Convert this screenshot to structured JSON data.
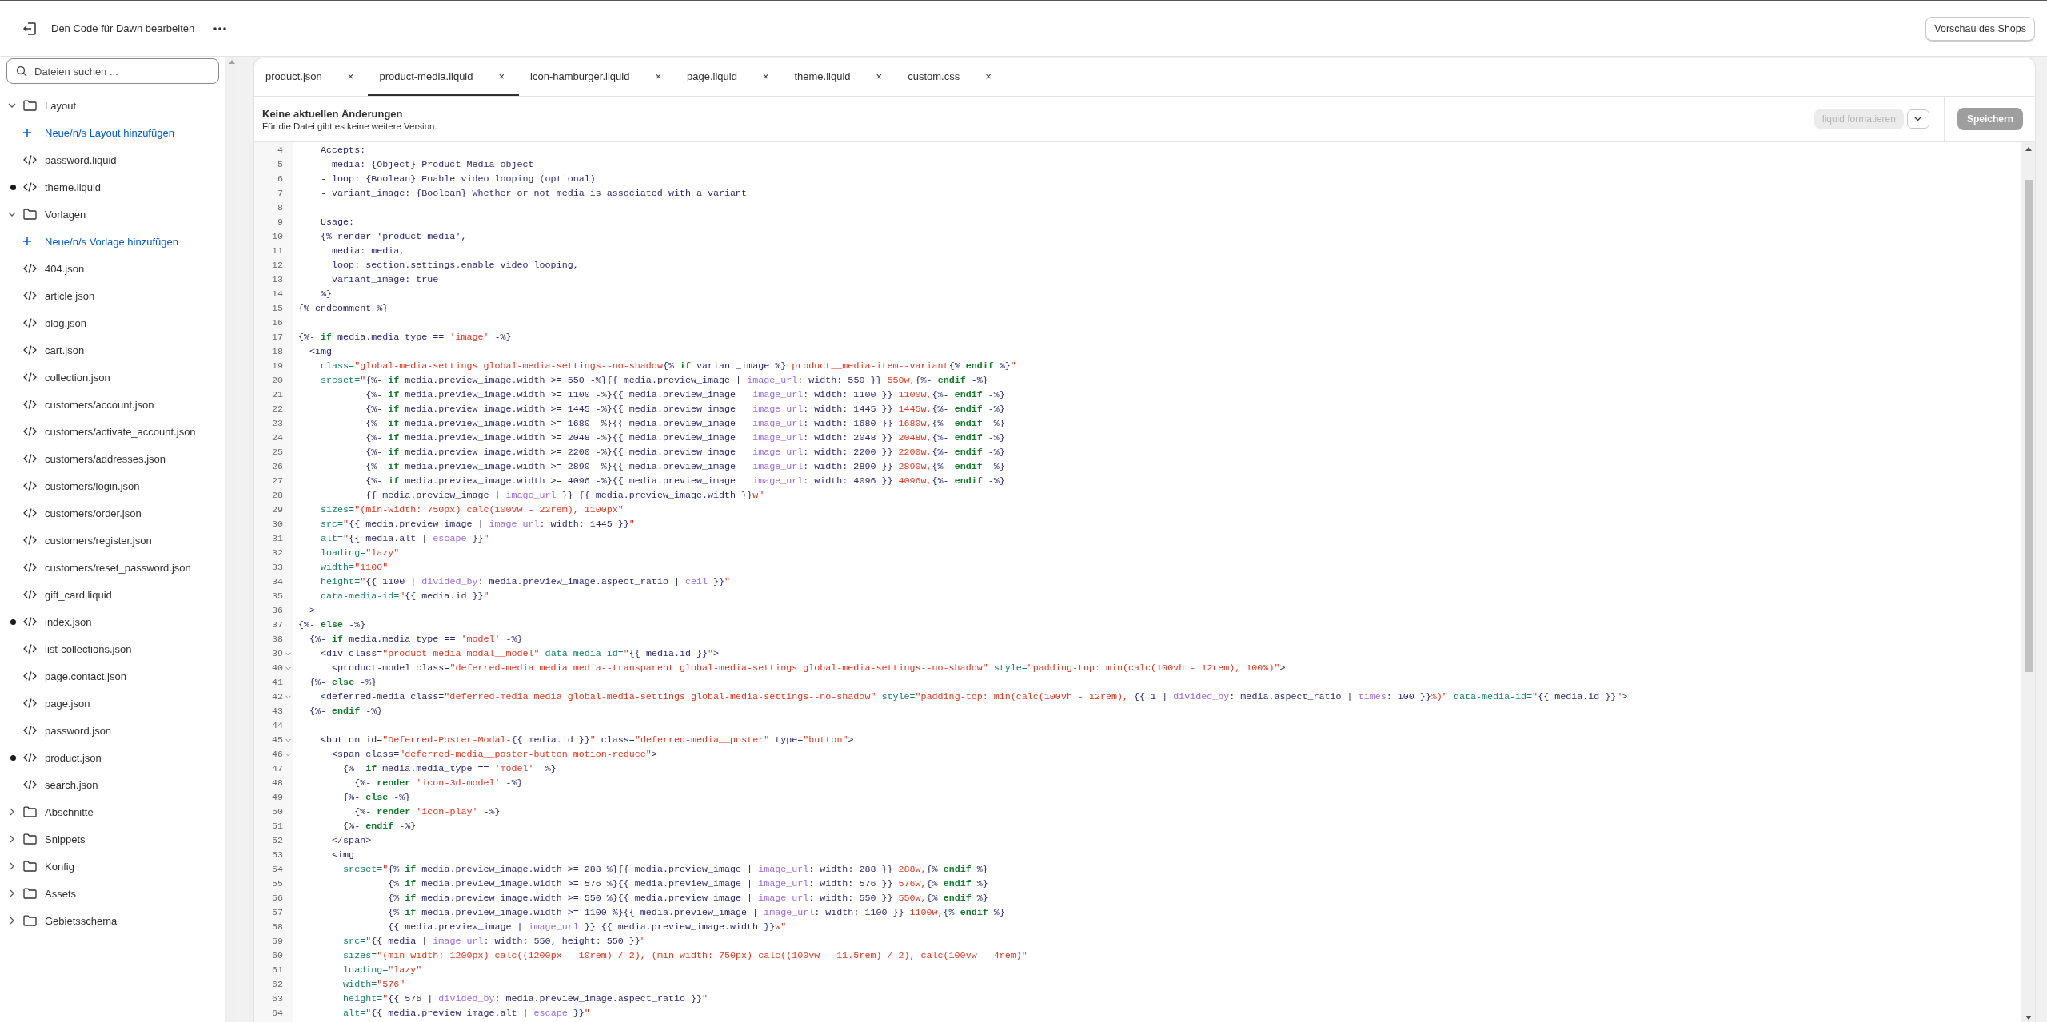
{
  "topbar": {
    "title": "Den Code für Dawn bearbeiten",
    "preview_button": "Vorschau des Shops"
  },
  "sidebar": {
    "search": {
      "placeholder": "Dateien suchen ..."
    },
    "items": [
      {
        "kind": "folder",
        "label": "Layout",
        "expanded": true,
        "children": [
          {
            "kind": "add",
            "label": "Neue/n/s Layout hinzufügen"
          },
          {
            "kind": "file",
            "label": "password.liquid",
            "modified": false
          },
          {
            "kind": "file",
            "label": "theme.liquid",
            "modified": true
          }
        ]
      },
      {
        "kind": "folder",
        "label": "Vorlagen",
        "expanded": true,
        "children": [
          {
            "kind": "add",
            "label": "Neue/n/s Vorlage hinzufügen"
          },
          {
            "kind": "file",
            "label": "404.json",
            "modified": false
          },
          {
            "kind": "file",
            "label": "article.json",
            "modified": false
          },
          {
            "kind": "file",
            "label": "blog.json",
            "modified": false
          },
          {
            "kind": "file",
            "label": "cart.json",
            "modified": false
          },
          {
            "kind": "file",
            "label": "collection.json",
            "modified": false
          },
          {
            "kind": "file",
            "label": "customers/account.json",
            "modified": false
          },
          {
            "kind": "file",
            "label": "customers/activate_account.json",
            "modified": false
          },
          {
            "kind": "file",
            "label": "customers/addresses.json",
            "modified": false
          },
          {
            "kind": "file",
            "label": "customers/login.json",
            "modified": false
          },
          {
            "kind": "file",
            "label": "customers/order.json",
            "modified": false
          },
          {
            "kind": "file",
            "label": "customers/register.json",
            "modified": false
          },
          {
            "kind": "file",
            "label": "customers/reset_password.json",
            "modified": false
          },
          {
            "kind": "file",
            "label": "gift_card.liquid",
            "modified": false
          },
          {
            "kind": "file",
            "label": "index.json",
            "modified": true
          },
          {
            "kind": "file",
            "label": "list-collections.json",
            "modified": false
          },
          {
            "kind": "file",
            "label": "page.contact.json",
            "modified": false
          },
          {
            "kind": "file",
            "label": "page.json",
            "modified": false
          },
          {
            "kind": "file",
            "label": "password.json",
            "modified": false
          },
          {
            "kind": "file",
            "label": "product.json",
            "modified": true
          },
          {
            "kind": "file",
            "label": "search.json",
            "modified": false
          }
        ]
      },
      {
        "kind": "folder",
        "label": "Abschnitte",
        "expanded": false
      },
      {
        "kind": "folder",
        "label": "Snippets",
        "expanded": false
      },
      {
        "kind": "folder",
        "label": "Konfig",
        "expanded": false
      },
      {
        "kind": "folder",
        "label": "Assets",
        "expanded": false
      },
      {
        "kind": "folder",
        "label": "Gebietsschema",
        "expanded": false
      }
    ]
  },
  "tabs": [
    {
      "label": "product.json",
      "close": "×",
      "selected": false
    },
    {
      "label": "product-media.liquid",
      "close": "×",
      "selected": true
    },
    {
      "label": "icon-hamburger.liquid",
      "close": "×",
      "selected": false
    },
    {
      "label": "page.liquid",
      "close": "×",
      "selected": false
    },
    {
      "label": "theme.liquid",
      "close": "×",
      "selected": false
    },
    {
      "label": "custom.css",
      "close": "×",
      "selected": false
    }
  ],
  "file_header": {
    "title": "Keine aktuellen Änderungen",
    "subtitle": "Für die Datei gibt es keine weitere Version.",
    "format_button": {
      "label": "liquid formatieren",
      "disabled": true
    },
    "save_button": {
      "label": "Speichern",
      "disabled": true
    }
  },
  "code_lines": [
    {
      "number": "4",
      "segments": [
        {
          "kind": "text",
          "text": "    Accepts:"
        }
      ]
    },
    {
      "number": "5",
      "segments": [
        {
          "kind": "text",
          "text": "    - media: {Object} Product Media object"
        }
      ]
    },
    {
      "number": "6",
      "segments": [
        {
          "kind": "text",
          "text": "    - loop: {Boolean} Enable video looping (optional)"
        }
      ]
    },
    {
      "number": "7",
      "segments": [
        {
          "kind": "text",
          "text": "    - variant_image: {Boolean} Whether or not media is associated with a variant"
        }
      ]
    },
    {
      "number": "8"
    },
    {
      "number": "9",
      "segments": [
        {
          "kind": "text",
          "text": "    Usage:"
        }
      ]
    },
    {
      "number": "10",
      "segments": [
        {
          "kind": "text",
          "text": "    {% render 'product-media',"
        }
      ]
    },
    {
      "number": "11",
      "segments": [
        {
          "kind": "text",
          "text": "      media: media,"
        }
      ]
    },
    {
      "number": "12",
      "segments": [
        {
          "kind": "text",
          "text": "      loop: section.settings.enable_video_looping,"
        }
      ]
    },
    {
      "number": "13",
      "segments": [
        {
          "kind": "text",
          "text": "      variant_image: true"
        }
      ]
    },
    {
      "number": "14",
      "segments": [
        {
          "kind": "text",
          "text": "    %}"
        }
      ]
    },
    {
      "number": "15",
      "segments": [
        {
          "kind": "text",
          "text": "{% endcomment %}"
        }
      ]
    },
    {
      "number": "16"
    },
    {
      "number": "17",
      "segments": [
        {
          "kind": "text",
          "text": "{%- "
        },
        {
          "kind": "keyword",
          "text": "if"
        },
        {
          "kind": "text",
          "text": " media.media_type == "
        },
        {
          "kind": "string",
          "text": "'image'"
        },
        {
          "kind": "text",
          "text": " -%}"
        }
      ]
    },
    {
      "number": "18",
      "segments": [
        {
          "kind": "text",
          "text": "  <img"
        }
      ]
    },
    {
      "number": "19",
      "segments": [
        {
          "kind": "attr",
          "text": "    class="
        },
        {
          "kind": "string",
          "text": "\"global-media-settings global-media-settings--no-shadow"
        },
        {
          "kind": "text",
          "text": "{% "
        },
        {
          "kind": "keyword",
          "text": "if"
        },
        {
          "kind": "text",
          "text": " variant_image %}"
        },
        {
          "kind": "string",
          "text": " product__media-item--variant"
        },
        {
          "kind": "text",
          "text": "{% "
        },
        {
          "kind": "keyword",
          "text": "endif"
        },
        {
          "kind": "text",
          "text": " %}"
        },
        {
          "kind": "string",
          "text": "\""
        }
      ]
    },
    {
      "number": "20",
      "segments": [
        {
          "kind": "attr",
          "text": "    srcset="
        },
        {
          "kind": "string",
          "text": "\""
        },
        {
          "kind": "text",
          "text": "{%- "
        },
        {
          "kind": "keyword",
          "text": "if"
        },
        {
          "kind": "text",
          "text": " media.preview_image.width >= 550 -%}{{ media.preview_image | "
        },
        {
          "kind": "filter",
          "text": "image_url"
        },
        {
          "kind": "text",
          "text": ": width: 550 }}"
        },
        {
          "kind": "string",
          "text": " 550w,"
        },
        {
          "kind": "text",
          "text": "{%- "
        },
        {
          "kind": "keyword",
          "text": "endif"
        },
        {
          "kind": "text",
          "text": " -%}"
        }
      ]
    },
    {
      "number": "21",
      "segments": [
        {
          "kind": "text",
          "text": "            {%- "
        },
        {
          "kind": "keyword",
          "text": "if"
        },
        {
          "kind": "text",
          "text": " media.preview_image.width >= 1100 -%}{{ media.preview_image | "
        },
        {
          "kind": "filter",
          "text": "image_url"
        },
        {
          "kind": "text",
          "text": ": width: 1100 }}"
        },
        {
          "kind": "string",
          "text": " 1100w,"
        },
        {
          "kind": "text",
          "text": "{%- "
        },
        {
          "kind": "keyword",
          "text": "endif"
        },
        {
          "kind": "text",
          "text": " -%}"
        }
      ]
    },
    {
      "number": "22",
      "segments": [
        {
          "kind": "text",
          "text": "            {%- "
        },
        {
          "kind": "keyword",
          "text": "if"
        },
        {
          "kind": "text",
          "text": " media.preview_image.width >= 1445 -%}{{ media.preview_image | "
        },
        {
          "kind": "filter",
          "text": "image_url"
        },
        {
          "kind": "text",
          "text": ": width: 1445 }}"
        },
        {
          "kind": "string",
          "text": " 1445w,"
        },
        {
          "kind": "text",
          "text": "{%- "
        },
        {
          "kind": "keyword",
          "text": "endif"
        },
        {
          "kind": "text",
          "text": " -%}"
        }
      ]
    },
    {
      "number": "23",
      "segments": [
        {
          "kind": "text",
          "text": "            {%- "
        },
        {
          "kind": "keyword",
          "text": "if"
        },
        {
          "kind": "text",
          "text": " media.preview_image.width >= 1680 -%}{{ media.preview_image | "
        },
        {
          "kind": "filter",
          "text": "image_url"
        },
        {
          "kind": "text",
          "text": ": width: 1680 }}"
        },
        {
          "kind": "string",
          "text": " 1680w,"
        },
        {
          "kind": "text",
          "text": "{%- "
        },
        {
          "kind": "keyword",
          "text": "endif"
        },
        {
          "kind": "text",
          "text": " -%}"
        }
      ]
    },
    {
      "number": "24",
      "segments": [
        {
          "kind": "text",
          "text": "            {%- "
        },
        {
          "kind": "keyword",
          "text": "if"
        },
        {
          "kind": "text",
          "text": " media.preview_image.width >= 2048 -%}{{ media.preview_image | "
        },
        {
          "kind": "filter",
          "text": "image_url"
        },
        {
          "kind": "text",
          "text": ": width: 2048 }}"
        },
        {
          "kind": "string",
          "text": " 2048w,"
        },
        {
          "kind": "text",
          "text": "{%- "
        },
        {
          "kind": "keyword",
          "text": "endif"
        },
        {
          "kind": "text",
          "text": " -%}"
        }
      ]
    },
    {
      "number": "25",
      "segments": [
        {
          "kind": "text",
          "text": "            {%- "
        },
        {
          "kind": "keyword",
          "text": "if"
        },
        {
          "kind": "text",
          "text": " media.preview_image.width >= 2200 -%}{{ media.preview_image | "
        },
        {
          "kind": "filter",
          "text": "image_url"
        },
        {
          "kind": "text",
          "text": ": width: 2200 }}"
        },
        {
          "kind": "string",
          "text": " 2200w,"
        },
        {
          "kind": "text",
          "text": "{%- "
        },
        {
          "kind": "keyword",
          "text": "endif"
        },
        {
          "kind": "text",
          "text": " -%}"
        }
      ]
    },
    {
      "number": "26",
      "segments": [
        {
          "kind": "text",
          "text": "            {%- "
        },
        {
          "kind": "keyword",
          "text": "if"
        },
        {
          "kind": "text",
          "text": " media.preview_image.width >= 2890 -%}{{ media.preview_image | "
        },
        {
          "kind": "filter",
          "text": "image_url"
        },
        {
          "kind": "text",
          "text": ": width: 2890 }}"
        },
        {
          "kind": "string",
          "text": " 2890w,"
        },
        {
          "kind": "text",
          "text": "{%- "
        },
        {
          "kind": "keyword",
          "text": "endif"
        },
        {
          "kind": "text",
          "text": " -%}"
        }
      ]
    },
    {
      "number": "27",
      "segments": [
        {
          "kind": "text",
          "text": "            {%- "
        },
        {
          "kind": "keyword",
          "text": "if"
        },
        {
          "kind": "text",
          "text": " media.preview_image.width >= 4096 -%}{{ media.preview_image | "
        },
        {
          "kind": "filter",
          "text": "image_url"
        },
        {
          "kind": "text",
          "text": ": width: 4096 }}"
        },
        {
          "kind": "string",
          "text": " 4096w,"
        },
        {
          "kind": "text",
          "text": "{%- "
        },
        {
          "kind": "keyword",
          "text": "endif"
        },
        {
          "kind": "text",
          "text": " -%}"
        }
      ]
    },
    {
      "number": "28",
      "segments": [
        {
          "kind": "text",
          "text": "            {{ media.preview_image | "
        },
        {
          "kind": "filter",
          "text": "image_url"
        },
        {
          "kind": "text",
          "text": " }} {{ media.preview_image.width }}"
        },
        {
          "kind": "string",
          "text": "w\""
        }
      ]
    },
    {
      "number": "29",
      "segments": [
        {
          "kind": "attr",
          "text": "    sizes="
        },
        {
          "kind": "string",
          "text": "\"(min-width: 750px) calc(100vw - 22rem), 1100px\""
        }
      ]
    },
    {
      "number": "30",
      "segments": [
        {
          "kind": "attr",
          "text": "    src="
        },
        {
          "kind": "string",
          "text": "\""
        },
        {
          "kind": "text",
          "text": "{{ media.preview_image | "
        },
        {
          "kind": "filter",
          "text": "image_url"
        },
        {
          "kind": "text",
          "text": ": width: 1445 }}"
        },
        {
          "kind": "string",
          "text": "\""
        }
      ]
    },
    {
      "number": "31",
      "segments": [
        {
          "kind": "attr",
          "text": "    alt="
        },
        {
          "kind": "string",
          "text": "\""
        },
        {
          "kind": "text",
          "text": "{{ media.alt | "
        },
        {
          "kind": "filter",
          "text": "escape"
        },
        {
          "kind": "text",
          "text": " }}"
        },
        {
          "kind": "string",
          "text": "\""
        }
      ]
    },
    {
      "number": "32",
      "segments": [
        {
          "kind": "attr",
          "text": "    loading="
        },
        {
          "kind": "string",
          "text": "\"lazy\""
        }
      ]
    },
    {
      "number": "33",
      "segments": [
        {
          "kind": "attr",
          "text": "    width="
        },
        {
          "kind": "string",
          "text": "\"1100\""
        }
      ]
    },
    {
      "number": "34",
      "segments": [
        {
          "kind": "attr",
          "text": "    height="
        },
        {
          "kind": "string",
          "text": "\""
        },
        {
          "kind": "text",
          "text": "{{ 1100 | "
        },
        {
          "kind": "filter",
          "text": "divided_by"
        },
        {
          "kind": "text",
          "text": ": media.preview_image.aspect_ratio | "
        },
        {
          "kind": "filter",
          "text": "ceil"
        },
        {
          "kind": "text",
          "text": " }}"
        },
        {
          "kind": "string",
          "text": "\""
        }
      ]
    },
    {
      "number": "35",
      "segments": [
        {
          "kind": "attr",
          "text": "    data-media-id="
        },
        {
          "kind": "string",
          "text": "\""
        },
        {
          "kind": "text",
          "text": "{{ media.id }}"
        },
        {
          "kind": "string",
          "text": "\""
        }
      ]
    },
    {
      "number": "36",
      "segments": [
        {
          "kind": "text",
          "text": "  >"
        }
      ]
    },
    {
      "number": "37",
      "segments": [
        {
          "kind": "text",
          "text": "{%- "
        },
        {
          "kind": "keyword",
          "text": "else"
        },
        {
          "kind": "text",
          "text": " -%}"
        }
      ]
    },
    {
      "number": "38",
      "segments": [
        {
          "kind": "text",
          "text": "  {%- "
        },
        {
          "kind": "keyword",
          "text": "if"
        },
        {
          "kind": "text",
          "text": " media.media_type == "
        },
        {
          "kind": "string",
          "text": "'model'"
        },
        {
          "kind": "text",
          "text": " -%}"
        }
      ]
    },
    {
      "number": "39",
      "foldable": true,
      "segments": [
        {
          "kind": "text",
          "text": "    <div class="
        },
        {
          "kind": "string",
          "text": "\"product-media-modal__model\""
        },
        {
          "kind": "attr",
          "text": " data-media-id="
        },
        {
          "kind": "string",
          "text": "\""
        },
        {
          "kind": "text",
          "text": "{{ media.id }}"
        },
        {
          "kind": "string",
          "text": "\""
        },
        {
          "kind": "text",
          "text": ">"
        }
      ]
    },
    {
      "number": "40",
      "foldable": true,
      "segments": [
        {
          "kind": "text",
          "text": "      <product-model class="
        },
        {
          "kind": "string",
          "text": "\"deferred-media media media--transparent global-media-settings global-media-settings--no-shadow\""
        },
        {
          "kind": "attr",
          "text": " style="
        },
        {
          "kind": "string",
          "text": "\"padding-top: min(calc(100vh - 12rem), 100%)\""
        },
        {
          "kind": "text",
          "text": ">"
        }
      ]
    },
    {
      "number": "41",
      "segments": [
        {
          "kind": "text",
          "text": "  {%- "
        },
        {
          "kind": "keyword",
          "text": "else"
        },
        {
          "kind": "text",
          "text": " -%}"
        }
      ]
    },
    {
      "number": "42",
      "foldable": true,
      "segments": [
        {
          "kind": "text",
          "text": "    <deferred-media class="
        },
        {
          "kind": "string",
          "text": "\"deferred-media media global-media-settings global-media-settings--no-shadow\""
        },
        {
          "kind": "attr",
          "text": " style="
        },
        {
          "kind": "string",
          "text": "\"padding-top: min(calc(100vh - 12rem), "
        },
        {
          "kind": "text",
          "text": "{{ 1 | "
        },
        {
          "kind": "filter",
          "text": "divided_by"
        },
        {
          "kind": "text",
          "text": ": media.aspect_ratio | "
        },
        {
          "kind": "filter",
          "text": "times"
        },
        {
          "kind": "text",
          "text": ": 100 }}"
        },
        {
          "kind": "string",
          "text": "%)\""
        },
        {
          "kind": "attr",
          "text": " data-media-id="
        },
        {
          "kind": "string",
          "text": "\""
        },
        {
          "kind": "text",
          "text": "{{ media.id }}"
        },
        {
          "kind": "string",
          "text": "\""
        },
        {
          "kind": "text",
          "text": ">"
        }
      ]
    },
    {
      "number": "43",
      "segments": [
        {
          "kind": "text",
          "text": "  {%- "
        },
        {
          "kind": "keyword",
          "text": "endif"
        },
        {
          "kind": "text",
          "text": " -%}"
        }
      ]
    },
    {
      "number": "44"
    },
    {
      "number": "45",
      "foldable": true,
      "segments": [
        {
          "kind": "text",
          "text": "    <button id="
        },
        {
          "kind": "string",
          "text": "\"Deferred-Poster-Modal-"
        },
        {
          "kind": "text",
          "text": "{{ media.id }}"
        },
        {
          "kind": "string",
          "text": "\""
        },
        {
          "kind": "text",
          "text": " class="
        },
        {
          "kind": "string",
          "text": "\"deferred-media__poster\""
        },
        {
          "kind": "text",
          "text": " type="
        },
        {
          "kind": "string",
          "text": "\"button\""
        },
        {
          "kind": "text",
          "text": ">"
        }
      ]
    },
    {
      "number": "46",
      "foldable": true,
      "segments": [
        {
          "kind": "text",
          "text": "      <span class="
        },
        {
          "kind": "string",
          "text": "\"deferred-media__poster-button motion-reduce\""
        },
        {
          "kind": "text",
          "text": ">"
        }
      ]
    },
    {
      "number": "47",
      "segments": [
        {
          "kind": "text",
          "text": "        {%- "
        },
        {
          "kind": "keyword",
          "text": "if"
        },
        {
          "kind": "text",
          "text": " media.media_type == "
        },
        {
          "kind": "string",
          "text": "'model'"
        },
        {
          "kind": "text",
          "text": " -%}"
        }
      ]
    },
    {
      "number": "48",
      "segments": [
        {
          "kind": "text",
          "text": "          {%- "
        },
        {
          "kind": "keyword",
          "text": "render"
        },
        {
          "kind": "string",
          "text": " 'icon-3d-model'"
        },
        {
          "kind": "text",
          "text": " -%}"
        }
      ]
    },
    {
      "number": "49",
      "segments": [
        {
          "kind": "text",
          "text": "        {%- "
        },
        {
          "kind": "keyword",
          "text": "else"
        },
        {
          "kind": "text",
          "text": " -%}"
        }
      ]
    },
    {
      "number": "50",
      "segments": [
        {
          "kind": "text",
          "text": "          {%- "
        },
        {
          "kind": "keyword",
          "text": "render"
        },
        {
          "kind": "string",
          "text": " 'icon-play'"
        },
        {
          "kind": "text",
          "text": " -%}"
        }
      ]
    },
    {
      "number": "51",
      "segments": [
        {
          "kind": "text",
          "text": "        {%- "
        },
        {
          "kind": "keyword",
          "text": "endif"
        },
        {
          "kind": "text",
          "text": " -%}"
        }
      ]
    },
    {
      "number": "52",
      "segments": [
        {
          "kind": "text",
          "text": "      </span>"
        }
      ]
    },
    {
      "number": "53",
      "segments": [
        {
          "kind": "text",
          "text": "      <img"
        }
      ]
    },
    {
      "number": "54",
      "segments": [
        {
          "kind": "attr",
          "text": "        srcset="
        },
        {
          "kind": "string",
          "text": "\""
        },
        {
          "kind": "text",
          "text": "{% "
        },
        {
          "kind": "keyword",
          "text": "if"
        },
        {
          "kind": "text",
          "text": " media.preview_image.width >= 288 %}{{ media.preview_image | "
        },
        {
          "kind": "filter",
          "text": "image_url"
        },
        {
          "kind": "text",
          "text": ": width: 288 }}"
        },
        {
          "kind": "string",
          "text": " 288w,"
        },
        {
          "kind": "text",
          "text": "{% "
        },
        {
          "kind": "keyword",
          "text": "endif"
        },
        {
          "kind": "text",
          "text": " %}"
        }
      ]
    },
    {
      "number": "55",
      "segments": [
        {
          "kind": "text",
          "text": "                {% "
        },
        {
          "kind": "keyword",
          "text": "if"
        },
        {
          "kind": "text",
          "text": " media.preview_image.width >= 576 %}{{ media.preview_image | "
        },
        {
          "kind": "filter",
          "text": "image_url"
        },
        {
          "kind": "text",
          "text": ": width: 576 }}"
        },
        {
          "kind": "string",
          "text": " 576w,"
        },
        {
          "kind": "text",
          "text": "{% "
        },
        {
          "kind": "keyword",
          "text": "endif"
        },
        {
          "kind": "text",
          "text": " %}"
        }
      ]
    },
    {
      "number": "56",
      "segments": [
        {
          "kind": "text",
          "text": "                {% "
        },
        {
          "kind": "keyword",
          "text": "if"
        },
        {
          "kind": "text",
          "text": " media.preview_image.width >= 550 %}{{ media.preview_image | "
        },
        {
          "kind": "filter",
          "text": "image_url"
        },
        {
          "kind": "text",
          "text": ": width: 550 }}"
        },
        {
          "kind": "string",
          "text": " 550w,"
        },
        {
          "kind": "text",
          "text": "{% "
        },
        {
          "kind": "keyword",
          "text": "endif"
        },
        {
          "kind": "text",
          "text": " %}"
        }
      ]
    },
    {
      "number": "57",
      "segments": [
        {
          "kind": "text",
          "text": "                {% "
        },
        {
          "kind": "keyword",
          "text": "if"
        },
        {
          "kind": "text",
          "text": " media.preview_image.width >= 1100 %}{{ media.preview_image | "
        },
        {
          "kind": "filter",
          "text": "image_url"
        },
        {
          "kind": "text",
          "text": ": width: 1100 }}"
        },
        {
          "kind": "string",
          "text": " 1100w,"
        },
        {
          "kind": "text",
          "text": "{% "
        },
        {
          "kind": "keyword",
          "text": "endif"
        },
        {
          "kind": "text",
          "text": " %}"
        }
      ]
    },
    {
      "number": "58",
      "segments": [
        {
          "kind": "text",
          "text": "                {{ media.preview_image | "
        },
        {
          "kind": "filter",
          "text": "image_url"
        },
        {
          "kind": "text",
          "text": " }} {{ media.preview_image.width }}"
        },
        {
          "kind": "string",
          "text": "w\""
        }
      ]
    },
    {
      "number": "59",
      "segments": [
        {
          "kind": "attr",
          "text": "        src="
        },
        {
          "kind": "string",
          "text": "\""
        },
        {
          "kind": "text",
          "text": "{{ media | "
        },
        {
          "kind": "filter",
          "text": "image_url"
        },
        {
          "kind": "text",
          "text": ": width: 550, height: 550 }}"
        },
        {
          "kind": "string",
          "text": "\""
        }
      ]
    },
    {
      "number": "60",
      "segments": [
        {
          "kind": "attr",
          "text": "        sizes="
        },
        {
          "kind": "string",
          "text": "\"(min-width: 1200px) calc((1200px - 10rem) / 2), (min-width: 750px) calc((100vw - 11.5rem) / 2), calc(100vw - 4rem)\""
        }
      ]
    },
    {
      "number": "61",
      "segments": [
        {
          "kind": "attr",
          "text": "        loading="
        },
        {
          "kind": "string",
          "text": "\"lazy\""
        }
      ]
    },
    {
      "number": "62",
      "segments": [
        {
          "kind": "attr",
          "text": "        width="
        },
        {
          "kind": "string",
          "text": "\"576\""
        }
      ]
    },
    {
      "number": "63",
      "segments": [
        {
          "kind": "attr",
          "text": "        height="
        },
        {
          "kind": "string",
          "text": "\""
        },
        {
          "kind": "text",
          "text": "{{ 576 | "
        },
        {
          "kind": "filter",
          "text": "divided_by"
        },
        {
          "kind": "text",
          "text": ": media.preview_image.aspect_ratio }}"
        },
        {
          "kind": "string",
          "text": "\""
        }
      ]
    },
    {
      "number": "64",
      "segments": [
        {
          "kind": "attr",
          "text": "        alt="
        },
        {
          "kind": "string",
          "text": "\""
        },
        {
          "kind": "text",
          "text": "{{ media.preview_image.alt | "
        },
        {
          "kind": "filter",
          "text": "escape"
        },
        {
          "kind": "text",
          "text": " }}"
        },
        {
          "kind": "string",
          "text": "\""
        }
      ]
    }
  ]
}
